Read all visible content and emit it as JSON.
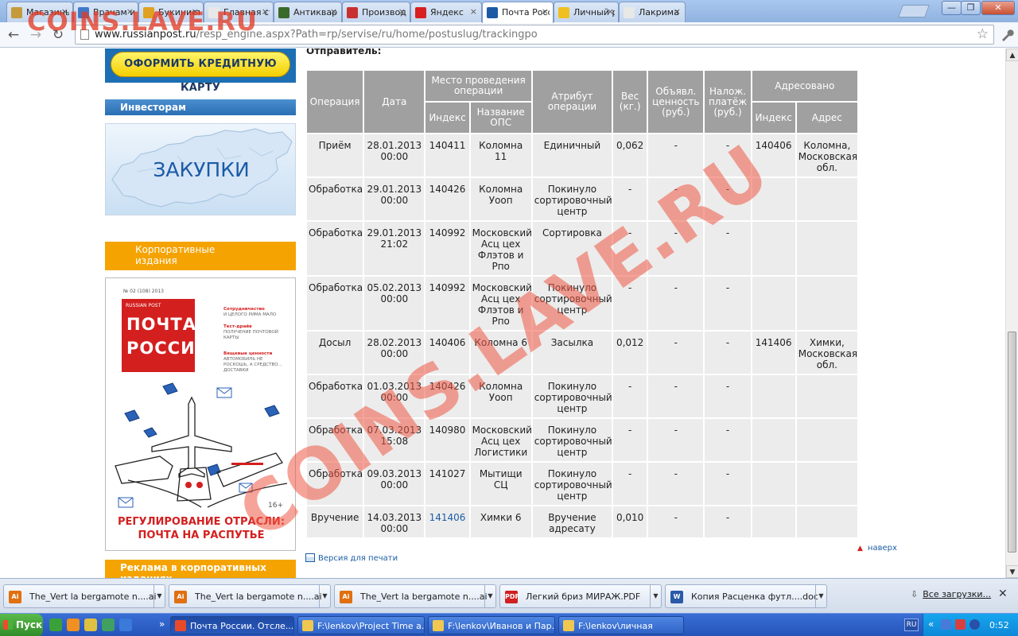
{
  "browser": {
    "tabs": [
      {
        "label": "Магазины",
        "icon_color": "#c49a3a"
      },
      {
        "label": "Врачам и ф",
        "icon_color": "#3f78c8"
      },
      {
        "label": "Букинисти",
        "icon_color": "#e0a020"
      },
      {
        "label": "Главная ст",
        "icon_color": "#e8e8e8"
      },
      {
        "label": "Антикварн",
        "icon_color": "#3a6a2a"
      },
      {
        "label": "Производи",
        "icon_color": "#c83030"
      },
      {
        "label": "Яндекс",
        "icon_color": "#d82020"
      },
      {
        "label": "Почта Росс",
        "icon_color": "#1c5aa6"
      },
      {
        "label": "Личный ра",
        "icon_color": "#f0c020"
      },
      {
        "label": "Лакрима",
        "icon_color": "#e8e8e8"
      }
    ],
    "window_buttons": {
      "minimize": "—",
      "restore": "❐",
      "close": "✕"
    },
    "url_domain": "www.russianpost.ru",
    "url_path": "/resp_engine.aspx?Path=rp/servise/ru/home/postuslug/trackingpo",
    "icons": {
      "back": "back-arrow-icon",
      "forward": "forward-arrow-icon",
      "reload": "reload-icon",
      "star": "bookmark-star-icon",
      "wrench": "wrench-icon"
    }
  },
  "sidebar": {
    "credit_button": "ОФОРМИТЬ КРЕДИТНУЮ КАРТУ",
    "investors_heading": "Инвесторам",
    "zakupki_label": "ЗАКУПКИ",
    "corporate_heading_line1": "Корпоративные",
    "corporate_heading_line2": "издания",
    "magazine": {
      "issue": "№ 02 (108) 2013",
      "brand": "RUSSIAN POST",
      "title_line1": "ПОЧТА",
      "title_line2": "РОССИИ",
      "blurbs": [
        {
          "head": "Сотрудничество",
          "sub": "И ЦЕЛОГО РИМА МАЛО"
        },
        {
          "head": "Тест-драйв",
          "sub": "ПОЛУЧЕНИЕ ПОЧТОВОЙ КАРТЫ"
        },
        {
          "head": "Вещевые ценности",
          "sub": "АВТОМОБИЛЬ НЕ РОСКОШЬ, А СРЕДСТВО... ДОСТАВКИ"
        }
      ],
      "age_rating": "16+",
      "footer_line1": "РЕГУЛИРОВАНИЕ ОТРАСЛИ:",
      "footer_line2": "ПОЧТА НА РАСПУТЬЕ"
    },
    "ad_heading": "Реклама в корпоративных изданиях"
  },
  "main": {
    "sender_label": "Отправитель:",
    "table": {
      "headers": {
        "operation": "Операция",
        "date": "Дата",
        "place_group": "Место проведения операции",
        "place_index": "Индекс",
        "place_name": "Название ОПС",
        "attribute": "Атрибут операции",
        "weight": "Вес (кг.)",
        "declared_value": "Объявл. ценность (руб.)",
        "cod": "Налож. платёж (руб.)",
        "addressed_group": "Адресовано",
        "addr_index": "Индекс",
        "addr_address": "Адрес"
      },
      "rows": [
        {
          "op": "Приём",
          "date": "28.01.2013 00:00",
          "idx": "140411",
          "ops": "Коломна 11",
          "attr": "Единичный",
          "weight": "0,062",
          "value": "-",
          "cod": "-",
          "to_idx": "140406",
          "to_addr": "Коломна, Московская обл."
        },
        {
          "op": "Обработка",
          "date": "29.01.2013 00:00",
          "idx": "140426",
          "ops": "Коломна Уооп",
          "attr": "Покинуло сортировочный центр",
          "weight": "-",
          "value": "-",
          "cod": "-",
          "to_idx": "",
          "to_addr": ""
        },
        {
          "op": "Обработка",
          "date": "29.01.2013 21:02",
          "idx": "140992",
          "ops": "Московский Асц цех Флэтов и Рпо",
          "attr": "Сортировка",
          "weight": "-",
          "value": "-",
          "cod": "-",
          "to_idx": "",
          "to_addr": ""
        },
        {
          "op": "Обработка",
          "date": "05.02.2013 00:00",
          "idx": "140992",
          "ops": "Московский Асц цех Флэтов и Рпо",
          "attr": "Покинуло сортировочный центр",
          "weight": "-",
          "value": "-",
          "cod": "-",
          "to_idx": "",
          "to_addr": ""
        },
        {
          "op": "Досыл",
          "date": "28.02.2013 00:00",
          "idx": "140406",
          "ops": "Коломна 6",
          "attr": "Засылка",
          "weight": "0,012",
          "value": "-",
          "cod": "-",
          "to_idx": "141406",
          "to_addr": "Химки, Московская обл."
        },
        {
          "op": "Обработка",
          "date": "01.03.2013 00:00",
          "idx": "140426",
          "ops": "Коломна Уооп",
          "attr": "Покинуло сортировочный центр",
          "weight": "-",
          "value": "-",
          "cod": "-",
          "to_idx": "",
          "to_addr": ""
        },
        {
          "op": "Обработка",
          "date": "07.03.2013 15:08",
          "idx": "140980",
          "ops": "Московский Асц цех Логистики",
          "attr": "Покинуло сортировочный центр",
          "weight": "-",
          "value": "-",
          "cod": "-",
          "to_idx": "",
          "to_addr": ""
        },
        {
          "op": "Обработка",
          "date": "09.03.2013 00:00",
          "idx": "141027",
          "ops": "Мытищи СЦ",
          "attr": "Покинуло сортировочный центр",
          "weight": "-",
          "value": "-",
          "cod": "-",
          "to_idx": "",
          "to_addr": ""
        },
        {
          "op": "Вручение",
          "date": "14.03.2013 00:00",
          "idx": "141406",
          "ops": "Химки 6",
          "attr": "Вручение адресату",
          "weight": "0,010",
          "value": "-",
          "cod": "-",
          "to_idx": "",
          "to_addr": "",
          "idx_is_link": true
        }
      ]
    },
    "print_link": "Версия для печати",
    "top_link": "наверх"
  },
  "watermarks": {
    "corner": "COINS.LAVE.RU",
    "diagonal": "COINS.LAVE.RU"
  },
  "downloads": {
    "items": [
      {
        "name": "The_Vert la bergamote n....ai",
        "type": "Ai",
        "color": "#e07010"
      },
      {
        "name": "The_Vert la bergamote n....ai",
        "type": "Ai",
        "color": "#e07010"
      },
      {
        "name": "The_Vert la bergamote n....ai",
        "type": "Ai",
        "color": "#e07010"
      },
      {
        "name": "Легкий бриз МИРАЖ.PDF",
        "type": "PDF",
        "color": "#d02020"
      },
      {
        "name": "Копия Расценка футл....doc",
        "type": "W",
        "color": "#2a5aa8"
      }
    ],
    "all_label": "Все загрузки...",
    "close": "✕"
  },
  "taskbar": {
    "start_label": "Пуск",
    "more_arrow": "»",
    "tasks": [
      {
        "label": "Почта России. Отсле...",
        "icon_color": "#e84a2a",
        "active": true
      },
      {
        "label": "F:\\lenkov\\Project Time a...",
        "icon_color": "#f0c850"
      },
      {
        "label": "F:\\lenkov\\Иванов и Пар...",
        "icon_color": "#f0c850"
      },
      {
        "label": "F:\\lenkov\\личная",
        "icon_color": "#f0c850"
      }
    ],
    "tray_more": "«",
    "language": "RU",
    "clock": "0:52"
  }
}
